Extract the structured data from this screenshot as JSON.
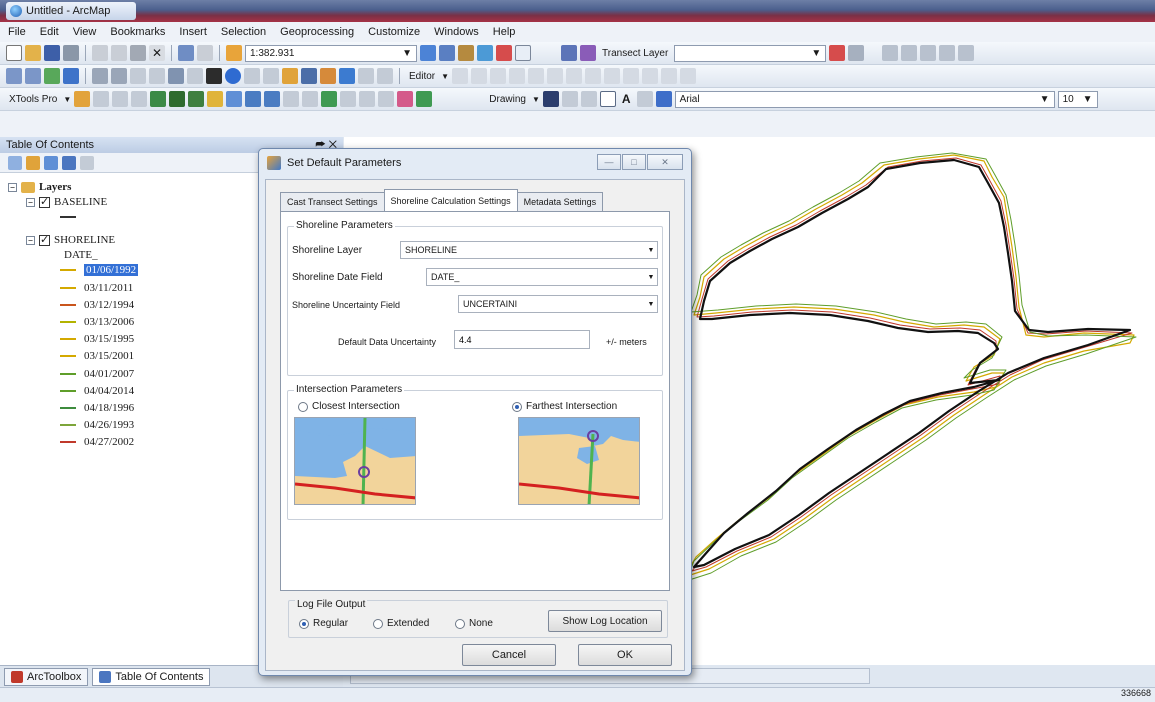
{
  "window": {
    "title": "Untitled - ArcMap"
  },
  "menu": [
    "File",
    "Edit",
    "View",
    "Bookmarks",
    "Insert",
    "Selection",
    "Geoprocessing",
    "Customize",
    "Windows",
    "Help"
  ],
  "toolbar": {
    "scale": "1:382.931",
    "transect_layer_label": "Transect Layer",
    "editor_label": "Editor",
    "xtools_label": "XTools Pro",
    "drawing_label": "Drawing",
    "font_name": "Arial",
    "font_size": "10"
  },
  "toc": {
    "title": "Table Of Contents",
    "pin": "⮫ ✕",
    "root": "Layers",
    "layers": [
      {
        "name": "BASELINE"
      },
      {
        "name": "SHORELINE",
        "field": "DATE_"
      }
    ],
    "dates": [
      {
        "label": "01/06/1992",
        "color": "#d4a900",
        "selected": true
      },
      {
        "label": "03/11/2011",
        "color": "#d4a900",
        "selected": false
      },
      {
        "label": "03/12/1994",
        "color": "#c9551c",
        "selected": false
      },
      {
        "label": "03/13/2006",
        "color": "#b3b300",
        "selected": false
      },
      {
        "label": "03/15/1995",
        "color": "#d4a900",
        "selected": false
      },
      {
        "label": "03/15/2001",
        "color": "#d4a900",
        "selected": false
      },
      {
        "label": "04/01/2007",
        "color": "#5f9e2a",
        "selected": false
      },
      {
        "label": "04/04/2014",
        "color": "#5f9e2a",
        "selected": false
      },
      {
        "label": "04/18/1996",
        "color": "#3e8c3e",
        "selected": false
      },
      {
        "label": "04/26/1993",
        "color": "#7da53a",
        "selected": false
      },
      {
        "label": "04/27/2002",
        "color": "#c0392b",
        "selected": false
      }
    ]
  },
  "bottom_tabs": {
    "toolbox": "ArcToolbox",
    "toc": "Table Of Contents"
  },
  "status": {
    "coordinate": "336668"
  },
  "dialog": {
    "title": "Set Default Parameters",
    "tabs": [
      "Cast Transect Settings",
      "Shoreline Calculation Settings",
      "Metadata Settings"
    ],
    "active_tab": 1,
    "shoreline_params": {
      "title": "Shoreline Parameters",
      "layer_label": "Shoreline Layer",
      "layer_value": "SHORELINE",
      "date_label": "Shoreline Date Field",
      "date_value": "DATE_",
      "uncert_label": "Shoreline Uncertainty Field",
      "uncert_value": "UNCERTAINI",
      "default_label": "Default Data Uncertainty",
      "default_value": "4.4",
      "unit": "+/- meters"
    },
    "intersection": {
      "title": "Intersection Parameters",
      "closest": "Closest Intersection",
      "farthest": "Farthest Intersection",
      "selected": "farthest"
    },
    "log": {
      "title": "Log File Output",
      "options": [
        "Regular",
        "Extended",
        "None"
      ],
      "selected": "Regular",
      "show_button": "Show Log Location"
    },
    "buttons": {
      "cancel": "Cancel",
      "ok": "OK"
    },
    "window_buttons": {
      "minimize": "—",
      "maximize": "□",
      "close": "✕"
    }
  },
  "colors": {
    "sand": "#f2d49b",
    "water": "#7fb3e6",
    "transect": "#4fb34f",
    "baseline": "#d42020",
    "marker": "#6b3fa0"
  }
}
